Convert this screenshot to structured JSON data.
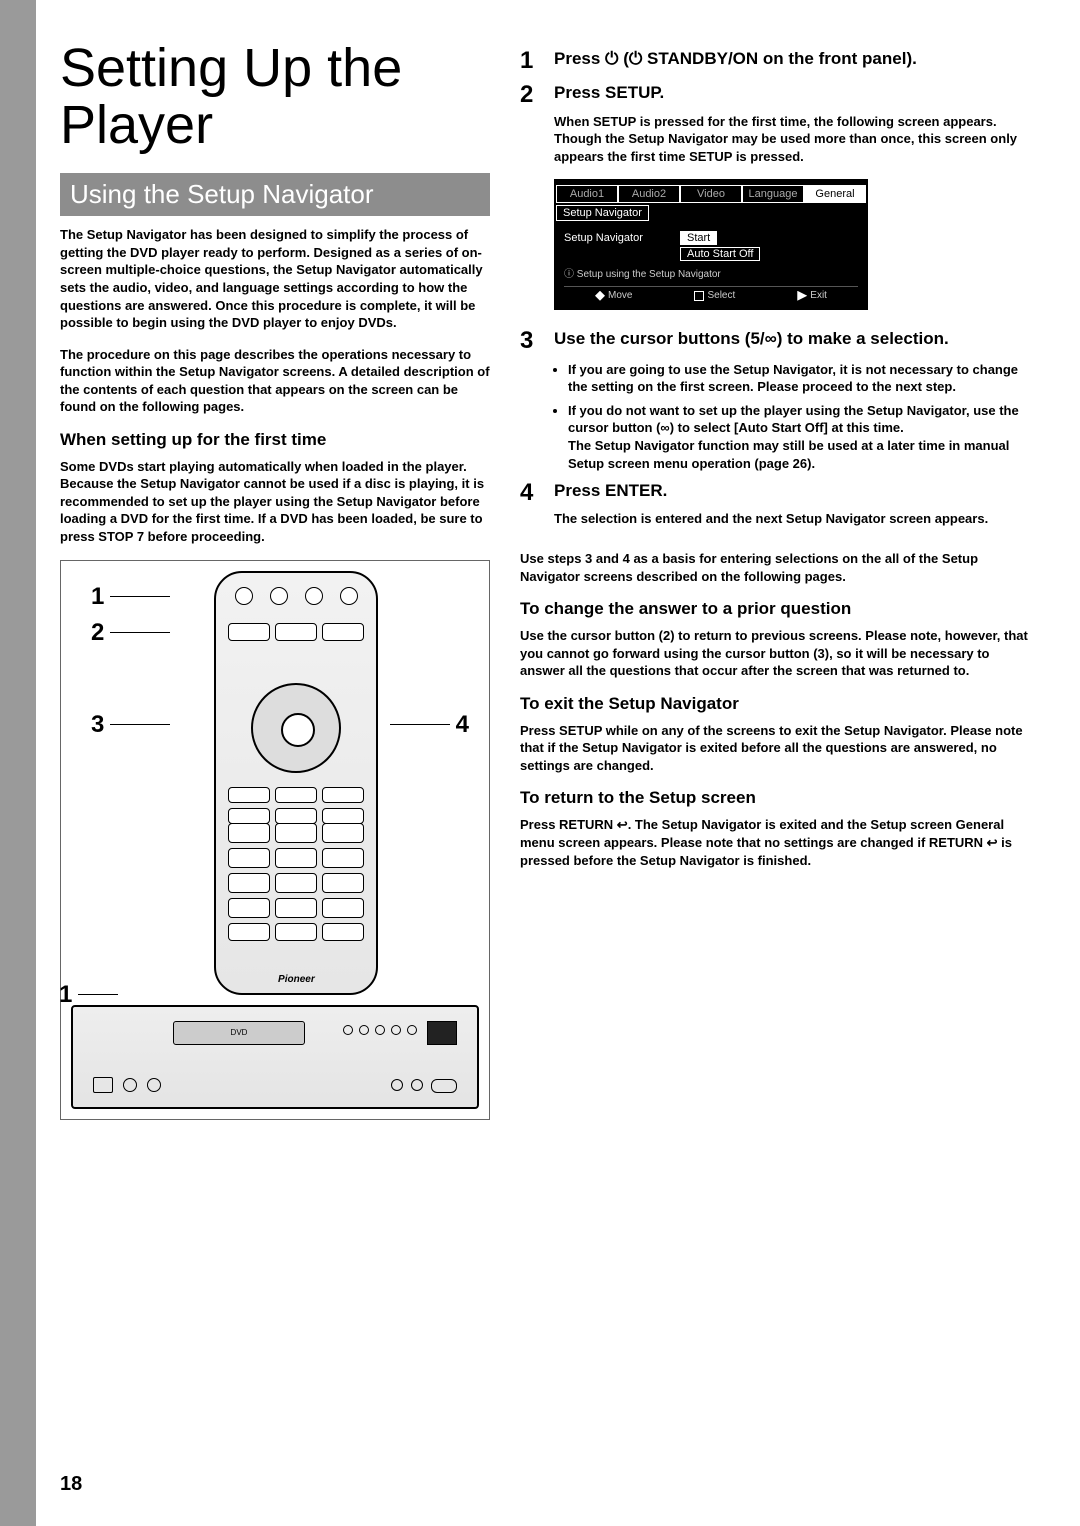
{
  "page_number": "18",
  "title": "Setting Up the Player",
  "section_heading": "Using the Setup Navigator",
  "intro_p1": "The Setup Navigator has been designed to simplify the process of getting the DVD player ready to perform. Designed as a series of on-screen multiple-choice questions, the Setup Navigator automatically sets the audio, video, and language settings according to how the questions are answered. Once this procedure is complete, it will be possible to begin using the DVD player to enjoy DVDs.",
  "intro_p2": "The procedure on this page describes the operations necessary to function within the Setup Navigator screens. A detailed description of the contents of each question that appears on the screen can be found on the following pages.",
  "first_time_heading": "When setting up for the first time",
  "first_time_body": "Some DVDs start playing automatically when loaded in the player. Because the Setup Navigator cannot be used if a disc is playing, it is recommended to set up the player using the Setup Navigator before loading a DVD for the first time. If a DVD has been loaded, be sure to press STOP 7 before proceeding.",
  "remote": {
    "callout1": "1",
    "callout2": "2",
    "callout3": "3",
    "callout4": "4",
    "brand": "Pioneer",
    "player_callout": "1",
    "tray_label": "DVD"
  },
  "steps": {
    "s1": {
      "num": "1",
      "title": "Press  ⏻  (⏻ STANDBY/ON on the front panel)."
    },
    "s2": {
      "num": "2",
      "title": "Press SETUP.",
      "body": "When SETUP is pressed for the first time, the following screen appears. Though the Setup Navigator may be used more than once, this screen only appears the first time SETUP is pressed."
    },
    "s3": {
      "num": "3",
      "title": "Use the cursor buttons (5/∞) to make a selection.",
      "bullet1": "If you are going to use the Setup Navigator, it is not necessary to change the setting on the first screen. Please proceed to the next step.",
      "bullet2_lead": "If you do not want to set up the player using the Setup Navigator, use the cursor button (∞) to select [Auto Start Off] at this time.",
      "bullet2_body": "The Setup Navigator function may still be used at a later time in manual Setup screen menu operation (page 26)."
    },
    "s4": {
      "num": "4",
      "title": "Press ENTER.",
      "body": "The selection is entered and the next Setup Navigator screen appears."
    }
  },
  "after_steps_note": "Use steps 3 and 4 as a basis for entering selections on the all of the Setup Navigator screens described on the following pages.",
  "change_answer": {
    "heading": "To change the answer to a prior question",
    "body": "Use the cursor button (2) to return to previous screens. Please note, however, that you cannot go forward using the cursor button (3), so it will be necessary to answer all the questions that occur after the screen that was returned to."
  },
  "exit_nav": {
    "heading": "To exit the Setup Navigator",
    "body": "Press SETUP while on any of the screens to exit the Setup Navigator. Please note that if the Setup Navigator is exited before all the questions are answered, no settings are changed."
  },
  "return_screen": {
    "heading": "To return to the Setup screen",
    "body": "Press RETURN ↩. The Setup Navigator is exited and the Setup screen General menu screen appears. Please note that no settings are changed if RETURN ↩ is pressed before the Setup Navigator is finished."
  },
  "osd": {
    "tabs": [
      "Audio1",
      "Audio2",
      "Video",
      "Language",
      "General"
    ],
    "active_tab_index": 4,
    "subtab": "Setup Navigator",
    "row1_label": "Setup Navigator",
    "row1_value": "Start",
    "row2_value": "Auto Start Off",
    "hint": "ⓘ Setup using the Setup Navigator",
    "footer": [
      "Move",
      "Select",
      "Exit"
    ]
  }
}
